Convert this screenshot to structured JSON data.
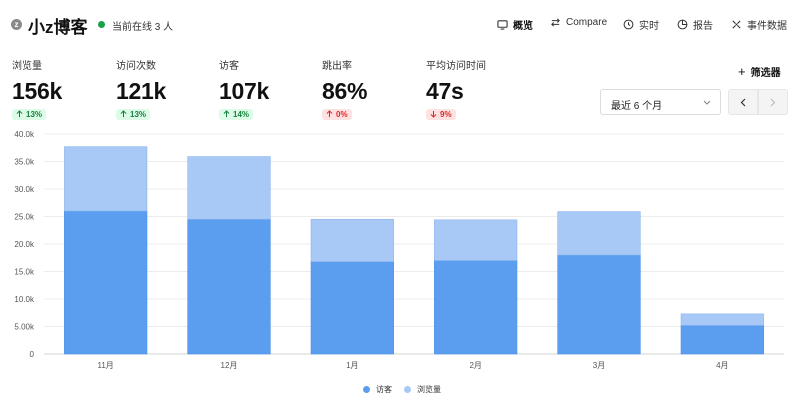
{
  "header": {
    "site_title": "小z博客",
    "online_text": "当前在线 3 人",
    "nav": {
      "overview": "概览",
      "compare": "Compare",
      "realtime": "实时",
      "reports": "报告",
      "events": "事件数据"
    }
  },
  "metrics": [
    {
      "label": "浏览量",
      "value": "156k",
      "change": "13%",
      "direction": "up"
    },
    {
      "label": "访问次数",
      "value": "121k",
      "change": "13%",
      "direction": "up"
    },
    {
      "label": "访客",
      "value": "107k",
      "change": "14%",
      "direction": "up"
    },
    {
      "label": "跳出率",
      "value": "86%",
      "change": "0%",
      "direction": "down"
    },
    {
      "label": "平均访问时间",
      "value": "47s",
      "change": "9%",
      "direction": "down"
    }
  ],
  "controls": {
    "filter_label": "筛选器",
    "date_range": "最近 6 个月"
  },
  "colors": {
    "visitors": "#5b9ef0",
    "pageviews": "#a8c8f5",
    "badge_up": "#15803d",
    "badge_down": "#dc2626"
  },
  "chart_data": {
    "type": "bar",
    "stacked": true,
    "categories": [
      "11月",
      "12月",
      "1月",
      "2月",
      "3月",
      "4月"
    ],
    "series": [
      {
        "name": "访客",
        "values": [
          26000,
          24500,
          16800,
          17000,
          18000,
          5200
        ]
      },
      {
        "name": "浏览量",
        "values": [
          11700,
          11400,
          7700,
          7400,
          7900,
          2100
        ]
      }
    ],
    "y_ticks": [
      "0",
      "5.00k",
      "10.0k",
      "15.0k",
      "20.0k",
      "25.0k",
      "30.0k",
      "35.0k",
      "40.0k"
    ],
    "ylim": [
      0,
      40000
    ],
    "grid": true,
    "legend_position": "bottom"
  }
}
